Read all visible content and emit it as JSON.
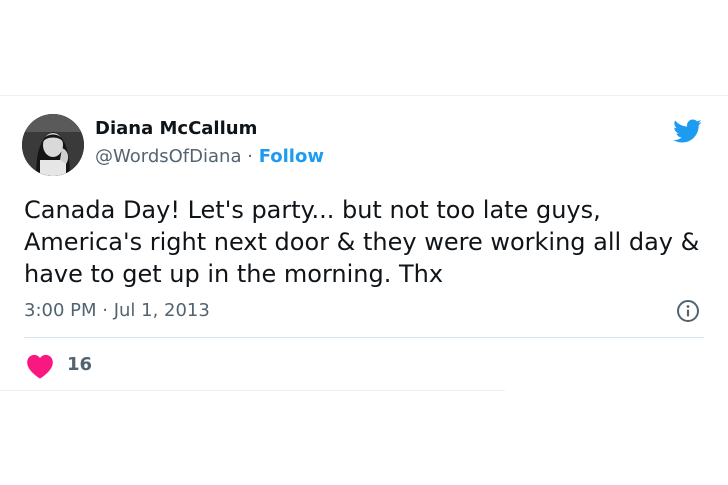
{
  "tweet": {
    "author_name": "Diana McCallum",
    "author_handle": "@WordsOfDiana",
    "separator": "·",
    "follow_label": "Follow",
    "text": "Canada Day! Let's party... but not too late guys, America's right next door & they were working all day & have to get up in the morning. Thx",
    "timestamp": "3:00 PM · Jul 1, 2013",
    "like_count": "16"
  },
  "icons": {
    "brand": "twitter-bird-icon",
    "info": "info-icon",
    "like": "heart-icon"
  },
  "colors": {
    "accent": "#1d9bf0",
    "text": "#0f1419",
    "secondary": "#536471",
    "like": "#f91880"
  }
}
